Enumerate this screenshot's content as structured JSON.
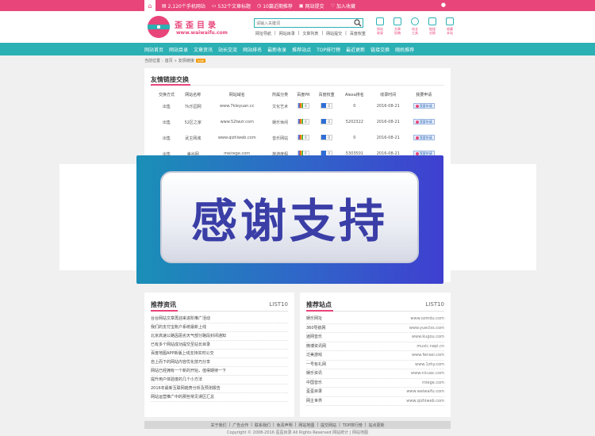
{
  "topbar": {
    "home_icon": "home-icon",
    "links": [
      {
        "icon": "rss-icon",
        "label": "2,120个手机网站"
      },
      {
        "icon": "chat-icon",
        "label": "532个文章标题"
      },
      {
        "icon": "clock-icon",
        "label": "10篇近期推荐"
      },
      {
        "icon": "desktop-icon",
        "label": "网站提交"
      },
      {
        "icon": "heart-icon",
        "label": "加入收藏"
      },
      {
        "icon": "user-icon",
        "label": ""
      }
    ]
  },
  "header": {
    "logo_text": "歪歪目录",
    "logo_url": "www.waiwaifu.com",
    "search_placeholder": "请输入关键词",
    "hotwords": [
      "网址导航",
      "网站目录",
      "文章列表",
      "网站提交",
      "百度权重"
    ],
    "icons": [
      {
        "icon": "site-icon",
        "label": "网站\n收录"
      },
      {
        "icon": "article-icon",
        "label": "文章\n投稿"
      },
      {
        "icon": "bulb-icon",
        "label": "站长\n工具"
      },
      {
        "icon": "pen-icon",
        "label": "链接\n交换"
      },
      {
        "icon": "star-icon",
        "label": "收藏\n本站"
      }
    ]
  },
  "nav": {
    "items": [
      "网站首页",
      "网站目录",
      "文章资讯",
      "站长交流",
      "网站排名",
      "最新收录",
      "推荐站点",
      "TOP排行榜",
      "最近更新",
      "链接交换",
      "随机推荐"
    ]
  },
  "breadcrumb": {
    "items": [
      "当前位置",
      "首页",
      "友情链接"
    ],
    "badge": "new"
  },
  "links_panel": {
    "title": "友情链接交换",
    "headers": [
      "交换方式",
      "网站名称",
      "网站域名",
      "所属分类",
      "百度PR",
      "百度权重",
      "Alexa排名",
      "收录时间",
      "我要申请"
    ],
    "rows": [
      {
        "mode": "出售",
        "name": "7k乐园网",
        "domain": "www.7kleyuan.cc",
        "category": "文化艺术",
        "pr": "0",
        "br": "0",
        "alexa": "0",
        "date": "2016-08-21",
        "action": "我要申请"
      },
      {
        "mode": "出售",
        "name": "52区之家",
        "domain": "www.52twzr.com",
        "category": "娱乐休闲",
        "pr": "0",
        "br": "0",
        "alexa": "5202322",
        "date": "2016-08-21",
        "action": "我要申请"
      },
      {
        "mode": "出售",
        "name": "武主网城",
        "domain": "www.qizhiweb.com",
        "category": "音乐网站",
        "pr": "0",
        "br": "0",
        "alexa": "0",
        "date": "2016-08-21",
        "action": "我要申请"
      },
      {
        "mode": "出售",
        "name": "美谷网",
        "domain": "meirege.com",
        "category": "旅游度假",
        "pr": "0",
        "br": "0",
        "alexa": "5303501",
        "date": "2016-08-21",
        "action": "我要申请"
      }
    ]
  },
  "overlay": {
    "text": "感谢支持"
  },
  "news_box": {
    "title": "推荐资讯",
    "tag": "LIST10",
    "items": [
      "台台网站文章再迎来进阶推广活动",
      "我们的支付宝账户系统最新上线",
      "北京高速公路因恶劣天气部分路段封闭通知",
      "已有多个网站成功提交至站长目录",
      "百度地图APP新版上线支持实时公交",
      "自上而下的网站内容优化技巧分享",
      "网站已经拥有一个新的开始，值得期待一下",
      "提升用户体验度的几个小方法",
      "2016年最新互联网趋势分析及预测报告",
      "网站运营推广中的那些常见误区汇总"
    ]
  },
  "sites_box": {
    "title": "推荐站点",
    "tag": "LIST10",
    "items": [
      {
        "name": "娱乐网址",
        "url": "www.ozmdu.com"
      },
      {
        "name": "360导航网",
        "url": "www.yueclss.com"
      },
      {
        "name": "逍网音乐",
        "url": "www.kugou.com"
      },
      {
        "name": "微博资讯网",
        "url": "music.nepi.cn"
      },
      {
        "name": "泛美游戏",
        "url": "www.fenxei.com"
      },
      {
        "name": "一号有礼网",
        "url": "www.1zhy.com"
      },
      {
        "name": "娱乐资讯",
        "url": "www.nicuac.com"
      },
      {
        "name": "中国音乐",
        "url": "miege.com"
      },
      {
        "name": "歪歪目录",
        "url": "www.waiwaifu.com"
      },
      {
        "name": "网主世界",
        "url": "www.qizhiweb.com"
      }
    ]
  },
  "footer": {
    "links": [
      "关于我们",
      "广告合作",
      "联系我们",
      "免责声明",
      "网站地图",
      "提交网站",
      "TOP排行榜",
      "站点更新"
    ],
    "copyright": "Copyright © 2008-2016 歪歪目录 All Rights Reserved 网站统计 | 网站地图"
  }
}
